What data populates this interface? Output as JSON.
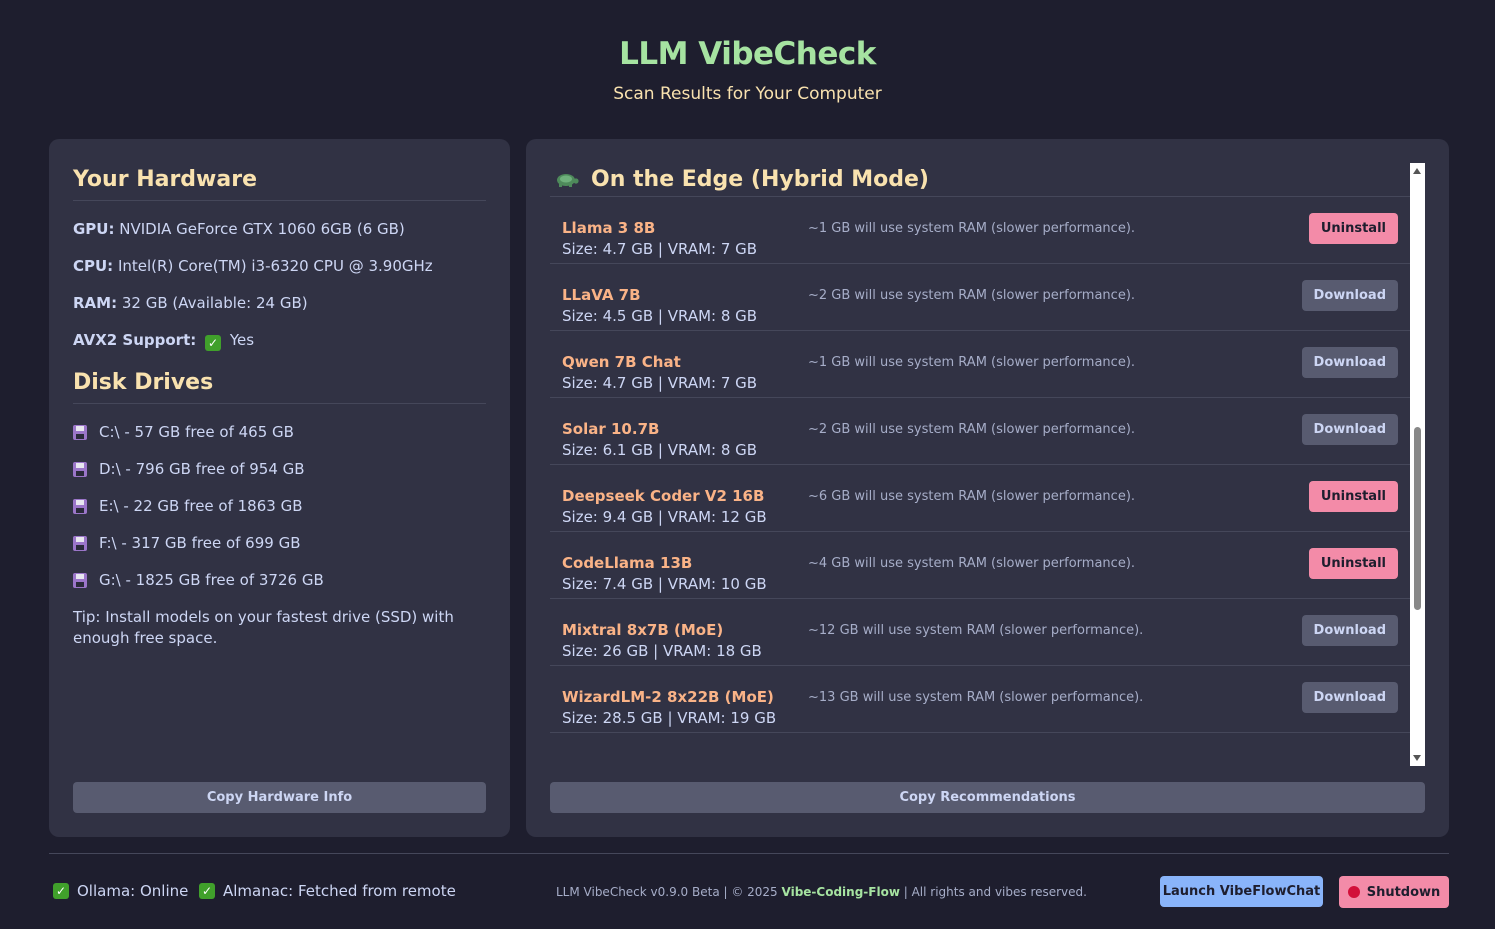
{
  "header": {
    "title": "LLM VibeCheck",
    "subtitle": "Scan Results for Your Computer"
  },
  "hardware": {
    "heading": "Your Hardware",
    "gpu_label": "GPU:",
    "gpu_value": "NVIDIA GeForce GTX 1060 6GB (6 GB)",
    "cpu_label": "CPU:",
    "cpu_value": "Intel(R) Core(TM) i3-6320 CPU @ 3.90GHz",
    "ram_label": "RAM:",
    "ram_value": "32 GB (Available: 24 GB)",
    "avx_label": "AVX2 Support:",
    "avx_value": "Yes",
    "copy_button": "Copy Hardware Info"
  },
  "disks": {
    "heading": "Disk Drives",
    "items": [
      "C:\\ - 57 GB free of 465 GB",
      "D:\\ - 796 GB free of 954 GB",
      "E:\\ - 22 GB free of 1863 GB",
      "F:\\ - 317 GB free of 699 GB",
      "G:\\ - 1825 GB free of 3726 GB"
    ],
    "tip": "Tip: Install models on your fastest drive (SSD) with enough free space."
  },
  "recommendations": {
    "tier_heading": "On the Edge (Hybrid Mode)",
    "tier_icon": "turtle-icon",
    "copy_button": "Copy Recommendations",
    "models": [
      {
        "name": "Llama 3 8B",
        "specs": "Size: 4.7 GB | VRAM: 7 GB",
        "note": "~1 GB will use system RAM (slower performance).",
        "action": "Uninstall"
      },
      {
        "name": "LLaVA 7B",
        "specs": "Size: 4.5 GB | VRAM: 8 GB",
        "note": "~2 GB will use system RAM (slower performance).",
        "action": "Download"
      },
      {
        "name": "Qwen 7B Chat",
        "specs": "Size: 4.7 GB | VRAM: 7 GB",
        "note": "~1 GB will use system RAM (slower performance).",
        "action": "Download"
      },
      {
        "name": "Solar 10.7B",
        "specs": "Size: 6.1 GB | VRAM: 8 GB",
        "note": "~2 GB will use system RAM (slower performance).",
        "action": "Download"
      },
      {
        "name": "Deepseek Coder V2 16B",
        "specs": "Size: 9.4 GB | VRAM: 12 GB",
        "note": "~6 GB will use system RAM (slower performance).",
        "action": "Uninstall"
      },
      {
        "name": "CodeLlama 13B",
        "specs": "Size: 7.4 GB | VRAM: 10 GB",
        "note": "~4 GB will use system RAM (slower performance).",
        "action": "Uninstall"
      },
      {
        "name": "Mixtral 8x7B (MoE)",
        "specs": "Size: 26 GB | VRAM: 18 GB",
        "note": "~12 GB will use system RAM (slower performance).",
        "action": "Download"
      },
      {
        "name": "WizardLM-2 8x22B (MoE)",
        "specs": "Size: 28.5 GB | VRAM: 19 GB",
        "note": "~13 GB will use system RAM (slower performance).",
        "action": "Download"
      }
    ]
  },
  "footer": {
    "ollama_status": "Ollama: Online",
    "almanac_status": "Almanac: Fetched from remote",
    "copyright_prefix": "LLM VibeCheck v0.9.0 Beta | © 2025 ",
    "brand": "Vibe-Coding-Flow",
    "copyright_suffix": " | All rights and vibes reserved.",
    "launch_button": "Launch VibeFlowChat",
    "shutdown_button": "Shutdown"
  },
  "colors": {
    "background": "#1e1e2e",
    "panel": "#313244",
    "title_green": "#a6e3a1",
    "heading_yellow": "#f9e2af",
    "model_orange": "#fab387",
    "uninstall_pink": "#f38ba8",
    "launch_blue": "#89b4fa"
  }
}
